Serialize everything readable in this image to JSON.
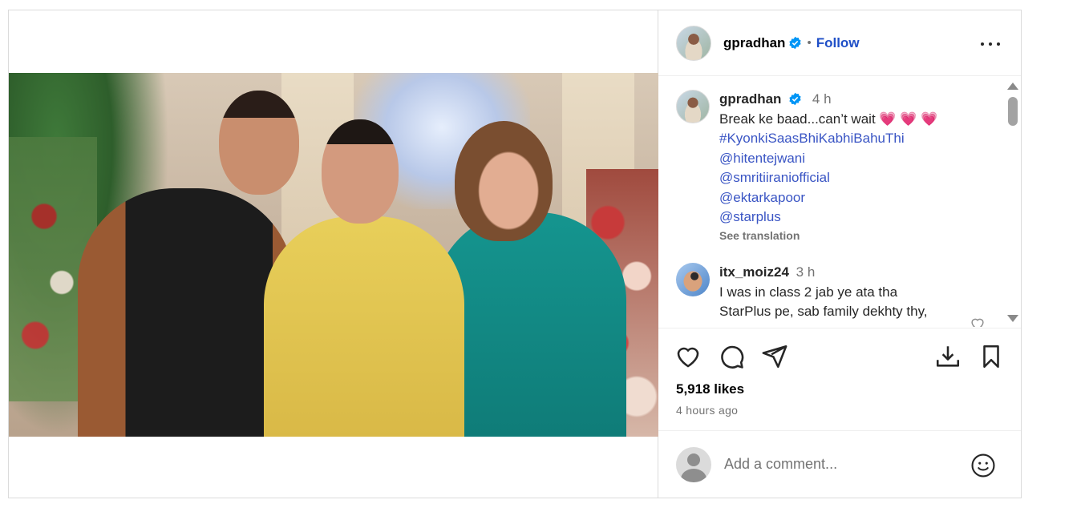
{
  "header": {
    "username": "gpradhan",
    "separator": "•",
    "follow_label": "Follow"
  },
  "caption": {
    "username": "gpradhan",
    "time": "4 h",
    "text": "Break ke baad...can’t wait",
    "emojis": "💗 💗 💗",
    "hashtag": "#KyonkiSaasBhiKabhiBahuThi",
    "mentions": [
      "@hitentejwani",
      "@smritiiraniofficial",
      "@ektarkapoor",
      "@starplus"
    ],
    "see_translation": "See translation"
  },
  "comment": {
    "username": "itx_moiz24",
    "time": "3 h",
    "lines": [
      "I was in class 2 jab ye ata tha",
      "StarPlus pe, sab family dekhty thy,"
    ]
  },
  "stats": {
    "likes": "5,918 likes",
    "time_ago": "4 hours ago"
  },
  "add_comment": {
    "placeholder": "Add a comment..."
  },
  "colors": {
    "link": "#3a55c4",
    "follow": "#1f4fc7",
    "verified": "#0095f6",
    "muted": "#737373"
  },
  "icons": [
    "more-icon",
    "verified-icon",
    "like-icon",
    "comment-icon",
    "share-icon",
    "save-icon",
    "download-icon",
    "emoji-icon"
  ]
}
